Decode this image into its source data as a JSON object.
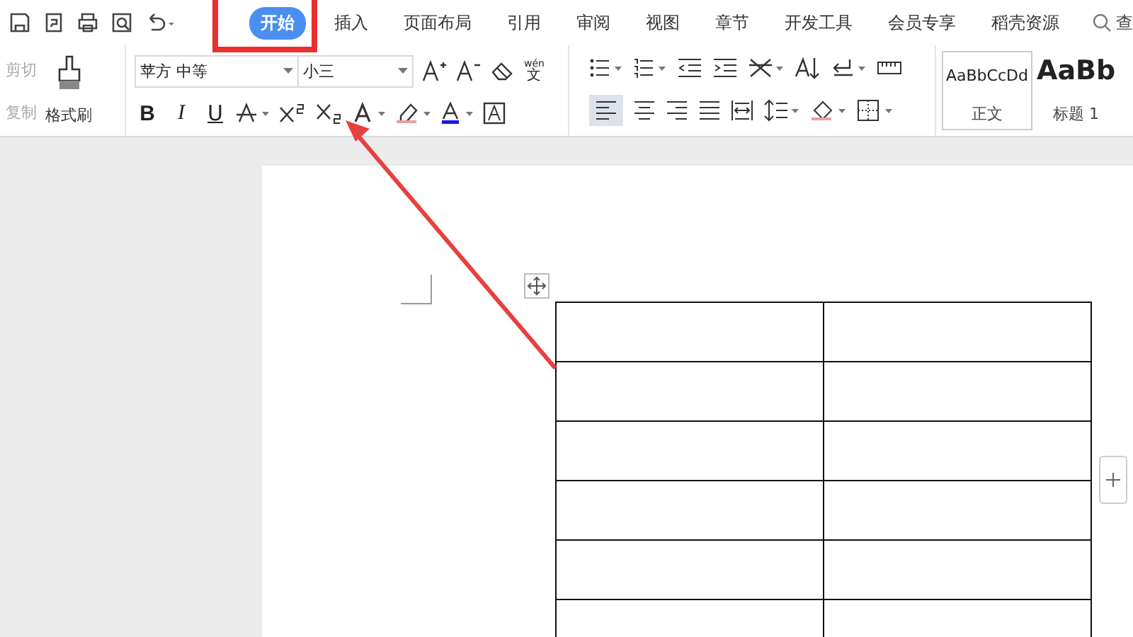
{
  "menu_tabs": [
    {
      "label": "开始",
      "selected": true
    },
    {
      "label": "插入",
      "selected": false
    },
    {
      "label": "页面布局",
      "selected": false
    },
    {
      "label": "引用",
      "selected": false
    },
    {
      "label": "审阅",
      "selected": false
    },
    {
      "label": "视图",
      "selected": false
    },
    {
      "label": "章节",
      "selected": false
    },
    {
      "label": "开发工具",
      "selected": false
    },
    {
      "label": "会员专享",
      "selected": false
    },
    {
      "label": "稻壳资源",
      "selected": false
    }
  ],
  "search": {
    "label": "查"
  },
  "clipboard": {
    "cut": {
      "label": "剪切",
      "disabled": true
    },
    "copy": {
      "label": "复制",
      "disabled": true
    },
    "format_painter": {
      "label": "格式刷"
    }
  },
  "font": {
    "family": "苹方 中等",
    "size": "小三",
    "bold": "B",
    "italic": "I",
    "underline": "U",
    "pinyin_top": "wén",
    "pinyin_char": "文"
  },
  "styles": [
    {
      "preview": "AaBbCcDd",
      "label": "正文",
      "selected": true
    },
    {
      "preview": "AaBb",
      "label": "标题 1",
      "selected": false
    }
  ]
}
